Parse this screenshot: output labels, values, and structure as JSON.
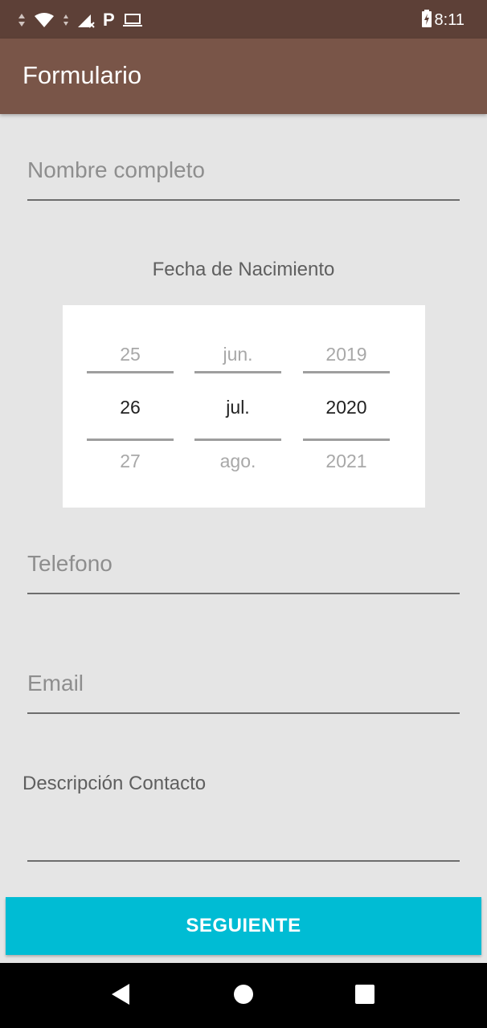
{
  "status_bar": {
    "carrier_icon": "P",
    "time": "8:11",
    "icons": [
      "data-arrows-icon",
      "wifi-icon",
      "signal-icon",
      "parking-icon",
      "laptop-icon",
      "battery-charging-icon"
    ]
  },
  "app_bar": {
    "title": "Formulario"
  },
  "form": {
    "name_placeholder": "Nombre completo",
    "birthdate_label": "Fecha de Nacimiento",
    "date_picker": {
      "day": {
        "prev": "25",
        "current": "26",
        "next": "27"
      },
      "month": {
        "prev": "jun.",
        "current": "jul.",
        "next": "ago."
      },
      "year": {
        "prev": "2019",
        "current": "2020",
        "next": "2021"
      }
    },
    "phone_placeholder": "Telefono",
    "email_placeholder": "Email",
    "description_label": "Descripción Contacto",
    "description_value": "",
    "next_button": "SEGUIENTE"
  },
  "nav_bar": {
    "icons": [
      "back-icon",
      "home-icon",
      "recents-icon"
    ]
  },
  "colors": {
    "status_bar": "#5d4037",
    "app_bar": "#795548",
    "background": "#e5e5e5",
    "button": "#00bcd4"
  }
}
